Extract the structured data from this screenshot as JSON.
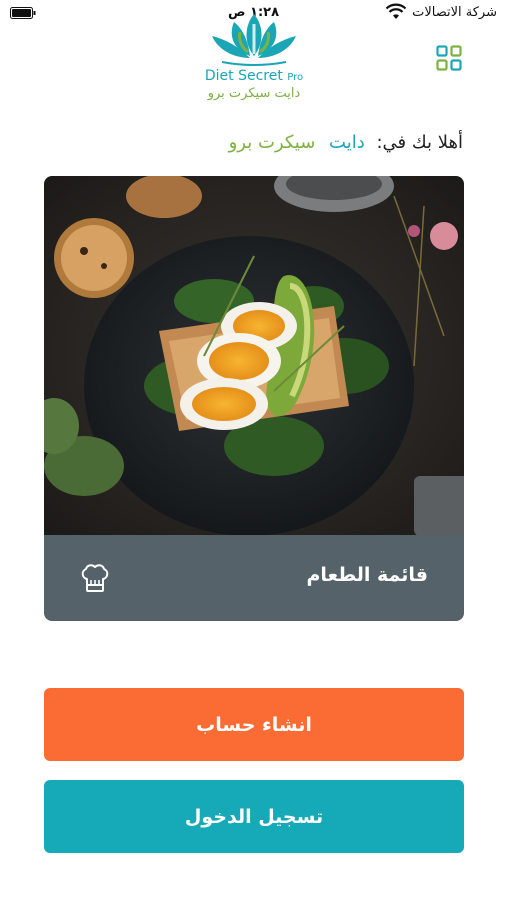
{
  "status_bar": {
    "carrier": "شركة الاتصالات",
    "time": "١:٢٨ ص",
    "icons": [
      "wifi-icon",
      "battery-icon"
    ]
  },
  "logo": {
    "brand_en": "Diet Secret",
    "brand_en_suffix": "Pro",
    "brand_ar": "دايت سيكرت برو"
  },
  "header": {
    "menu_icon": "grid-icon"
  },
  "welcome": {
    "greeting": "أهلا بك في:",
    "brand_word1": "دايت",
    "brand_word2": "سيكرت برو"
  },
  "food_card": {
    "menu_label": "قائمة الطعام",
    "icon": "chef-hat-icon"
  },
  "buttons": {
    "register": "انشاء حساب",
    "login": "تسجيل الدخول"
  },
  "colors": {
    "teal": "#1aa6b5",
    "green": "#7bb241",
    "orange": "#fb6c35",
    "login_teal": "#16a9b8",
    "menu_gray": "#56626a"
  }
}
